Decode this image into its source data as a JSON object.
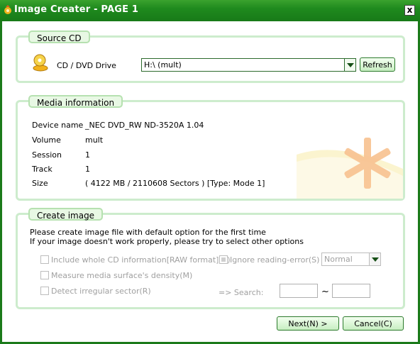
{
  "window": {
    "title": "Image Creater - PAGE 1",
    "close_label": "x"
  },
  "source_cd": {
    "title": "Source CD",
    "drive_label": "CD / DVD Drive",
    "drive_value": "H:\\ (mult)",
    "refresh_label": "Refresh"
  },
  "media_info": {
    "title": "Media information",
    "rows": [
      {
        "label": "Device name",
        "value": "_NEC DVD_RW ND-3520A 1.04"
      },
      {
        "label": "Volume",
        "value": "mult"
      },
      {
        "label": "Session",
        "value": "1"
      },
      {
        "label": "Track",
        "value": "1"
      },
      {
        "label": "Size",
        "value": "( 4122 MB / 2110608 Sectors ) [Type: Mode 1]"
      }
    ]
  },
  "create_image": {
    "title": "Create image",
    "desc_line1": "Please create image file with default option for the first time",
    "desc_line2": "If your image doesn't work properly, please try to select other options",
    "opt_raw": "Include whole CD information[RAW format](A)",
    "opt_ignore": "Ignore reading-error(S)",
    "speed_value": "Normal",
    "opt_density": "Measure media surface's density(M)",
    "opt_irregular": "Detect irregular sector(R)",
    "search_label": "=> Search:",
    "range_sep": "~"
  },
  "footer": {
    "next_label": "Next(N) >",
    "cancel_label": "Cancel(C)"
  },
  "colors": {
    "title_bar": "#1f8a1e",
    "group_border": "#cdeccd",
    "group_title_bg": "#e8f8e4",
    "accent_star": "#f4a261"
  }
}
